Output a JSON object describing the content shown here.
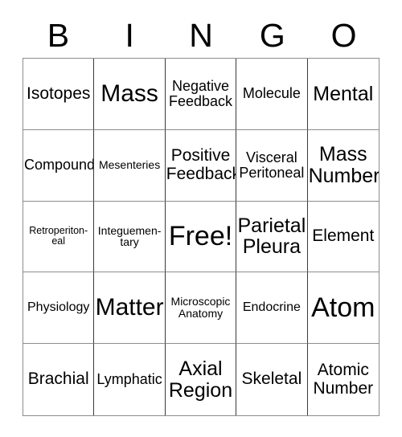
{
  "card": {
    "title": "BINGO",
    "header_letters": [
      "B",
      "I",
      "N",
      "G",
      "O"
    ],
    "free_space_label": "Free!",
    "colors": {
      "background": "#ffffff",
      "text": "#000000",
      "outer_border": "#8c8c8c",
      "inner_border": "#3a3a3a"
    },
    "grid": {
      "columns": 5,
      "rows": 5,
      "cells": [
        {
          "text": "Isotopes",
          "size": "fs-md"
        },
        {
          "text": "Mass",
          "size": "fs-xl"
        },
        {
          "text": "Negative\nFeedback",
          "size": "fs-sm"
        },
        {
          "text": "Molecule",
          "size": "fs-sm"
        },
        {
          "text": "Mental",
          "size": "fs-lg"
        },
        {
          "text": "Compound",
          "size": "fs-sm"
        },
        {
          "text": "Mesenteries",
          "size": "fs-xxs"
        },
        {
          "text": "Positive\nFeedback",
          "size": "fs-md"
        },
        {
          "text": "Visceral\nPeritoneal",
          "size": "fs-sm"
        },
        {
          "text": "Mass\nNumber",
          "size": "fs-lg"
        },
        {
          "text": "Retroperiton-\neal",
          "size": "fs-xxxs"
        },
        {
          "text": "Integuemen-\ntary",
          "size": "fs-xxs"
        },
        {
          "text": "Free!",
          "size": "fs-xxl"
        },
        {
          "text": "Parietal\nPleura",
          "size": "fs-lg"
        },
        {
          "text": "Element",
          "size": "fs-md"
        },
        {
          "text": "Physiology",
          "size": "fs-xs"
        },
        {
          "text": "Matter",
          "size": "fs-xl"
        },
        {
          "text": "Microscopic\nAnatomy",
          "size": "fs-xxs"
        },
        {
          "text": "Endocrine",
          "size": "fs-xs"
        },
        {
          "text": "Atom",
          "size": "fs-xxl"
        },
        {
          "text": "Brachial",
          "size": "fs-md"
        },
        {
          "text": "Lymphatic",
          "size": "fs-sm"
        },
        {
          "text": "Axial\nRegion",
          "size": "fs-lg"
        },
        {
          "text": "Skeletal",
          "size": "fs-md"
        },
        {
          "text": "Atomic\nNumber",
          "size": "fs-md"
        }
      ]
    }
  }
}
